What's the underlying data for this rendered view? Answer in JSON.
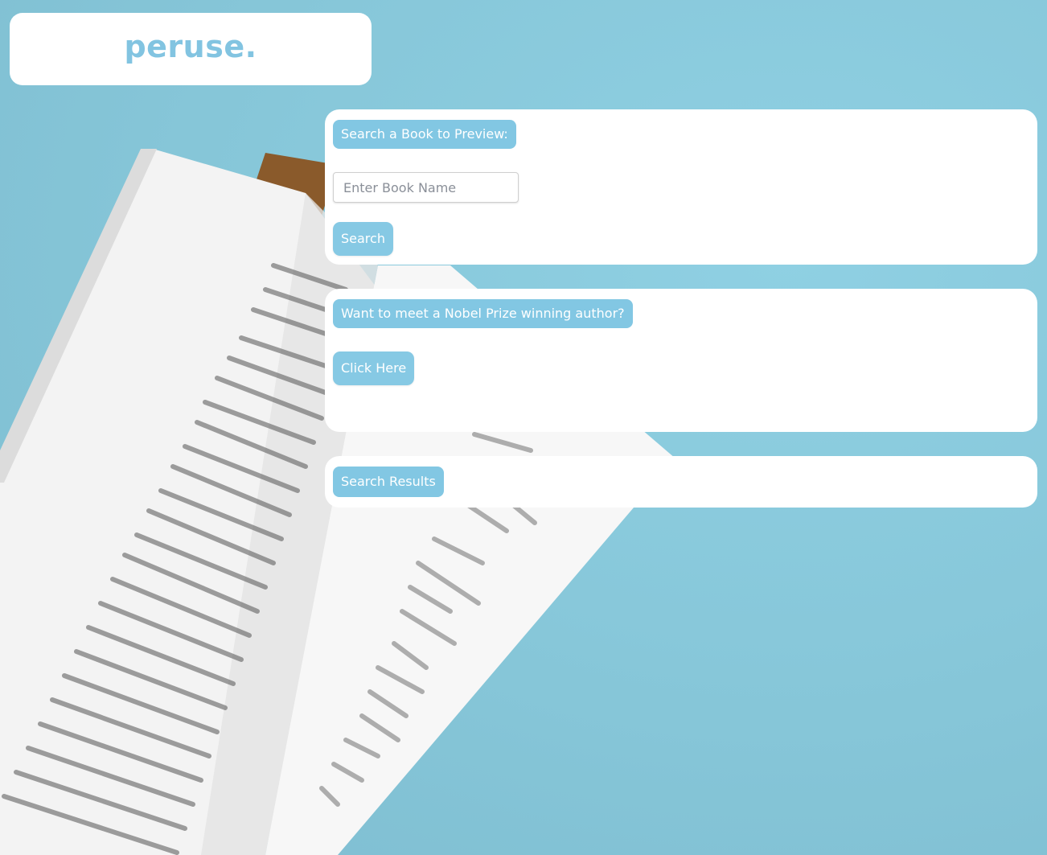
{
  "brand": {
    "logo_text": "peruse."
  },
  "search_panel": {
    "heading": "Search a Book to Preview:",
    "input_placeholder": "Enter Book Name",
    "input_value": "",
    "button_label": "Search"
  },
  "nobel_panel": {
    "heading": "Want to meet a Nobel Prize winning author?",
    "button_label": "Click Here"
  },
  "results_panel": {
    "heading": "Search Results"
  },
  "colors": {
    "accent": "#82c7e3",
    "background": "#86c6d8",
    "panel": "#ffffff"
  },
  "background_image": {
    "subject": "open-book-on-blue-background"
  }
}
